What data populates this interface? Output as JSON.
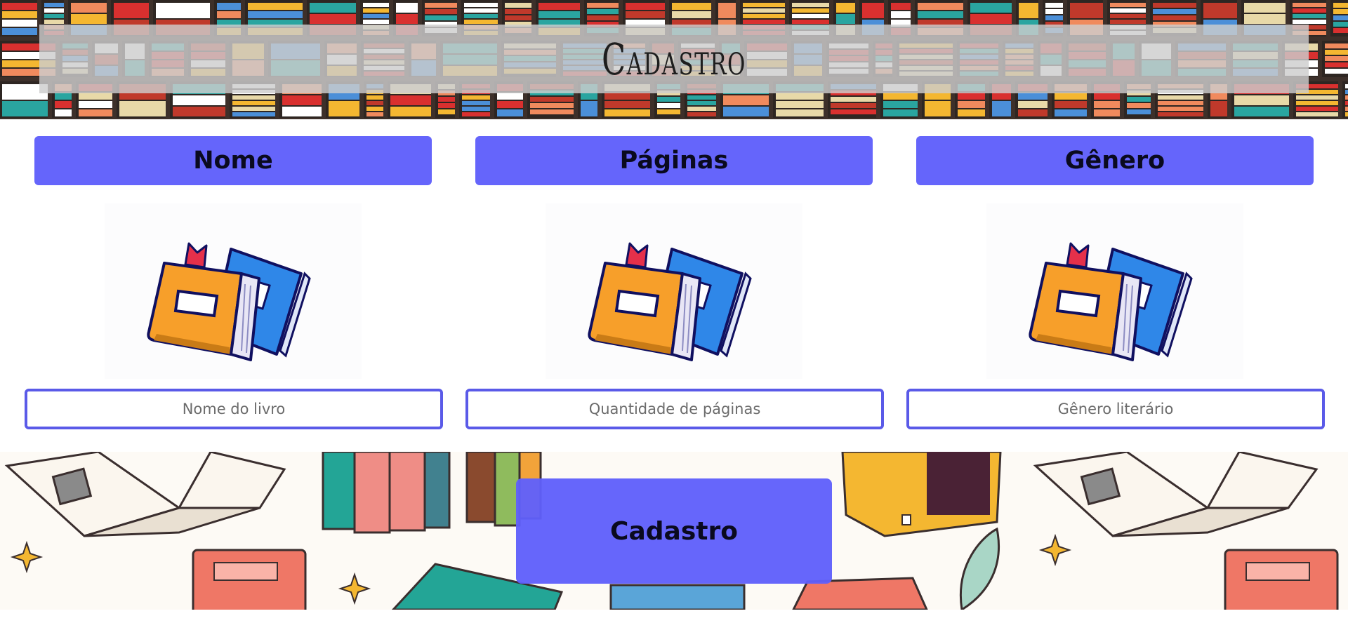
{
  "header": {
    "title": "Cadastro"
  },
  "form": {
    "columns": [
      {
        "label": "Nome",
        "placeholder": "Nome do livro"
      },
      {
        "label": "Páginas",
        "placeholder": "Quantidade de páginas"
      },
      {
        "label": "Gênero",
        "placeholder": "Gênero literário"
      }
    ],
    "submit_label": "Cadastro"
  },
  "colors": {
    "accent": "#6565fb",
    "input_border": "#5a5ae8",
    "background": "#ffffff"
  },
  "icons": {
    "column_image": "books-illustration"
  }
}
